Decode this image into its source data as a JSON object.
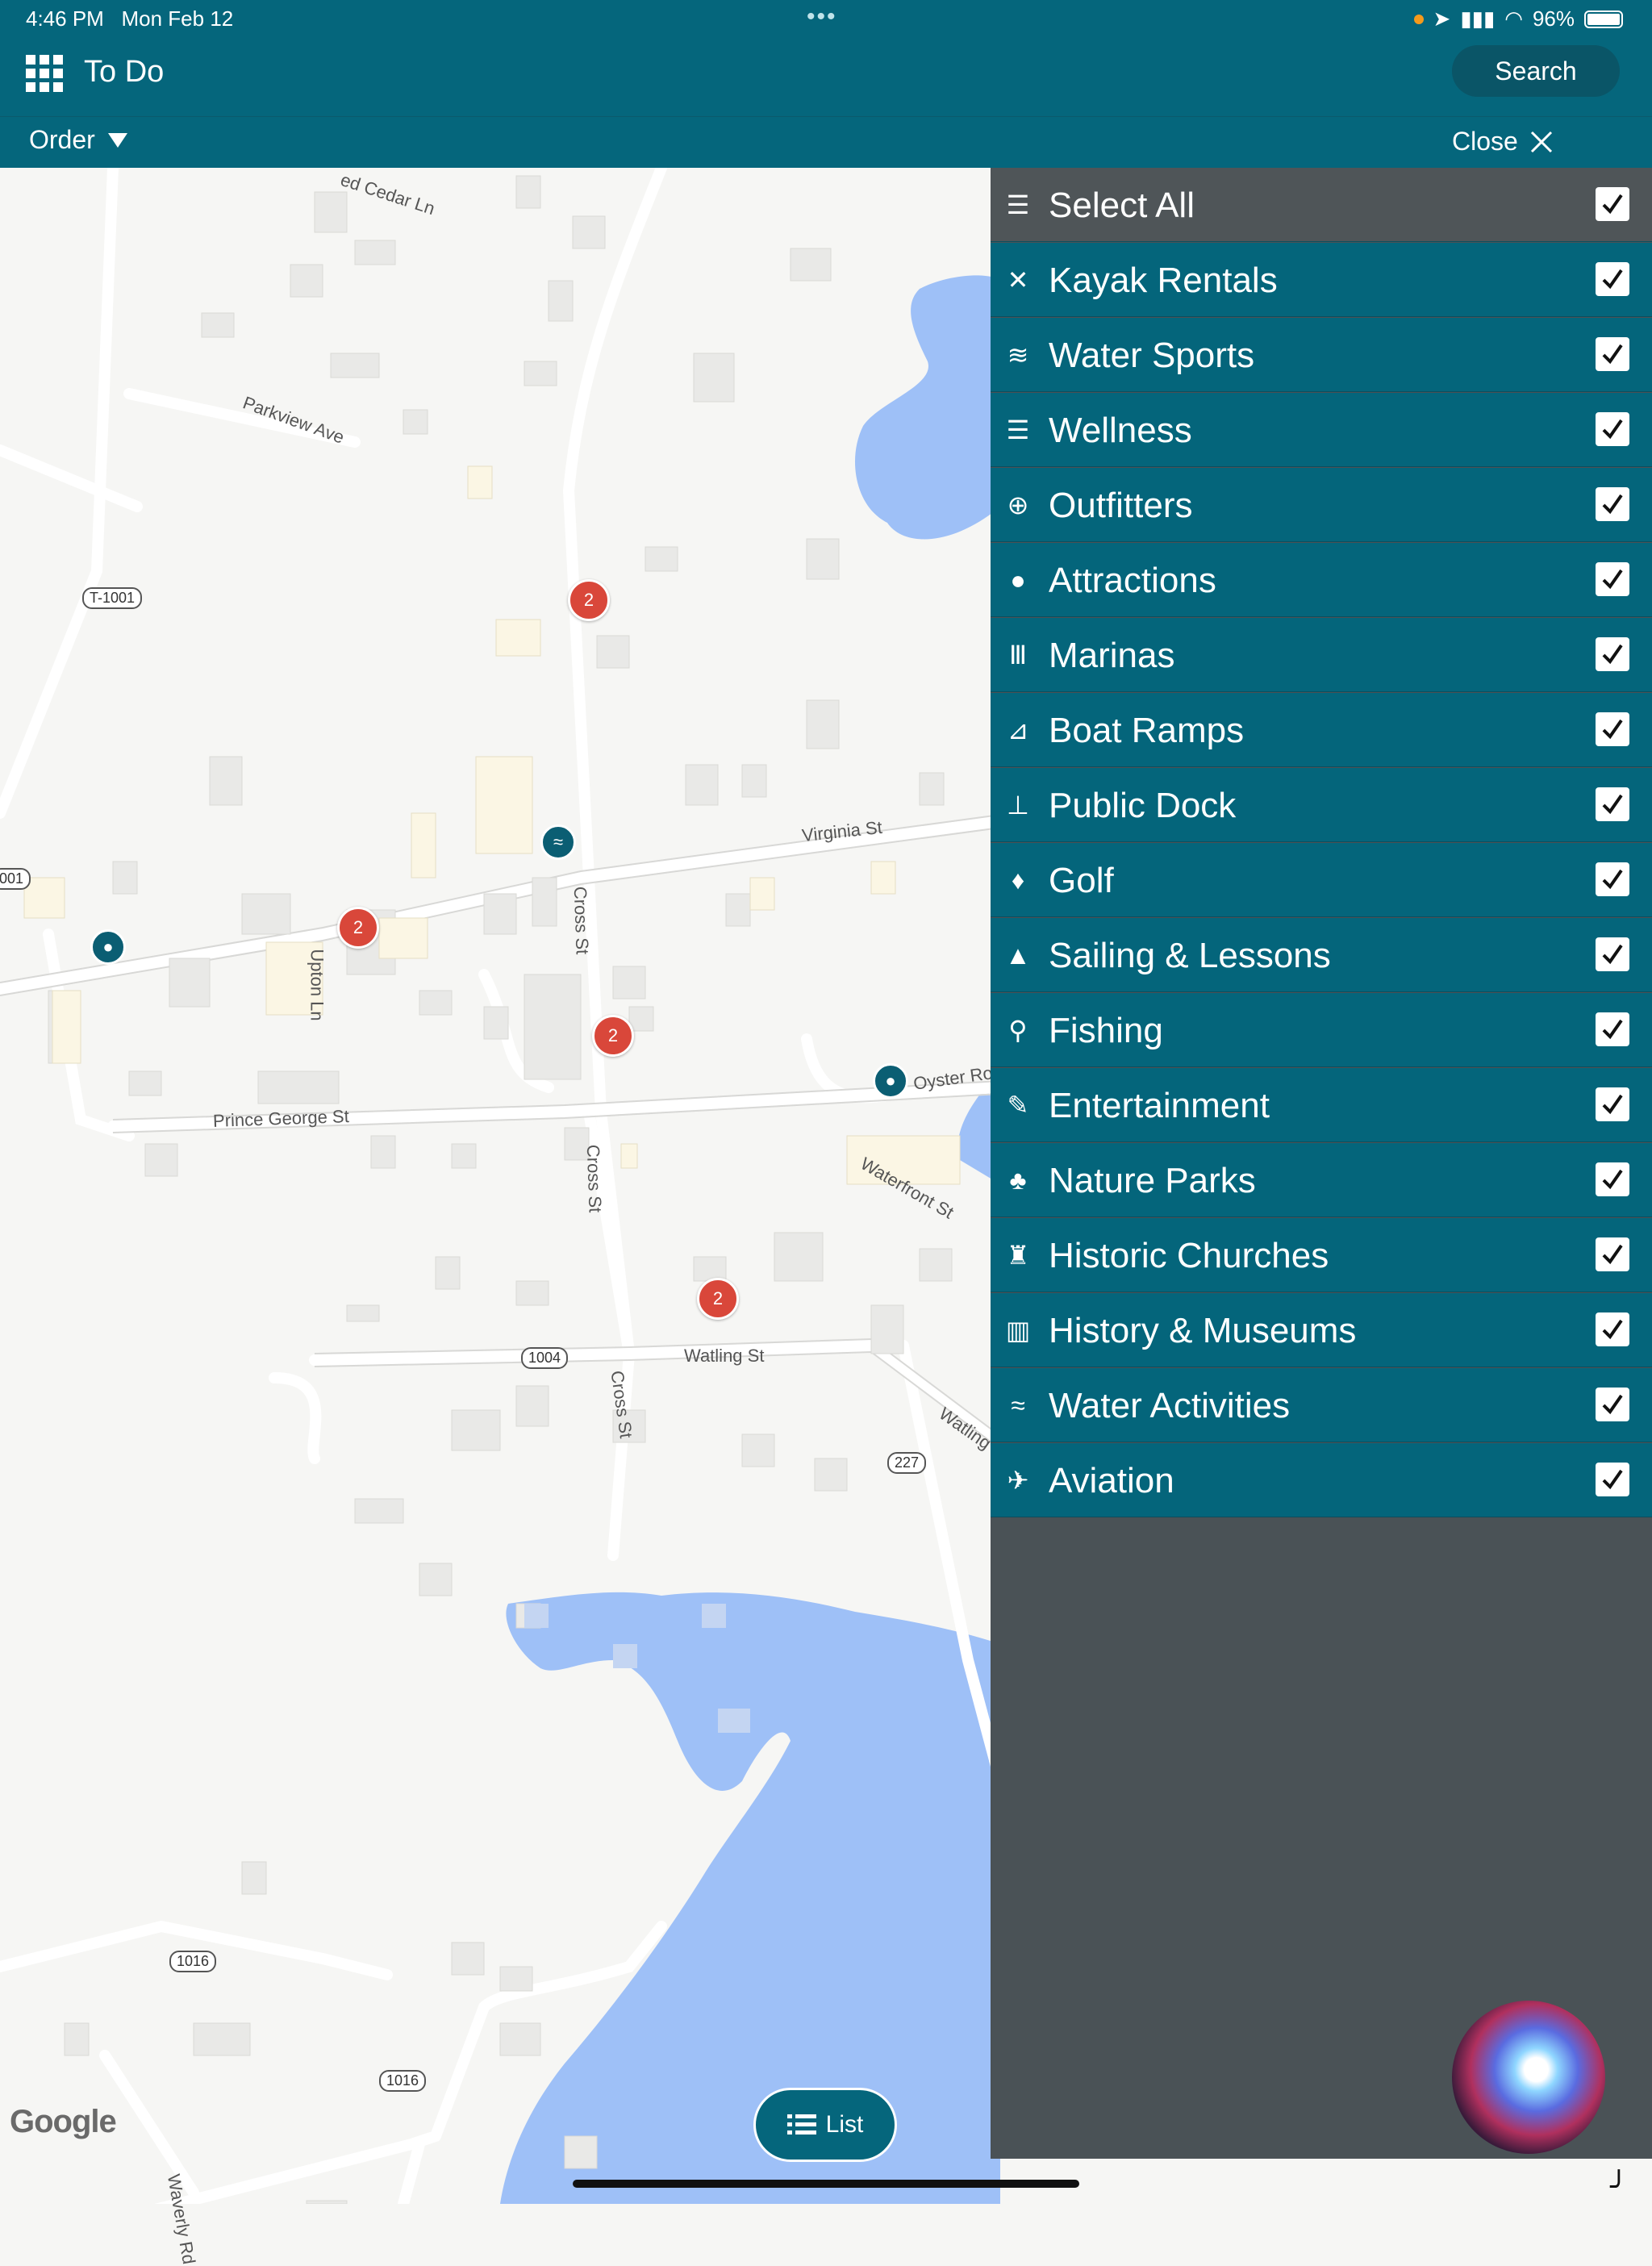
{
  "status_bar": {
    "time": "4:46 PM",
    "date": "Mon Feb 12",
    "battery": "96%",
    "dots": "•••"
  },
  "navbar": {
    "menu_icon": "grid-icon",
    "title": "To Do",
    "search_label": "Search"
  },
  "toolbar": {
    "order_label": "Order",
    "close_label": "Close"
  },
  "map": {
    "streets": {
      "cedar": "ed Cedar Ln",
      "parkview": "Parkview Ave",
      "upton": "Upton Ln",
      "cross1": "Cross St",
      "cross2": "Cross St",
      "cross3": "Cross St",
      "virginia": "Virginia St",
      "prince_george": "Prince George St",
      "oyster": "Oyster Ro",
      "waterfront": "Waterfront St",
      "watling": "Watling St",
      "watling2": "Watling",
      "waverly": "Waverly Rd"
    },
    "shields": {
      "t1001": "T-1001",
      "r001": "001",
      "r1004": "1004",
      "r227": "227",
      "r1016a": "1016",
      "r1016b": "1016"
    },
    "clusters": [
      "2",
      "2",
      "2",
      "2"
    ],
    "google": "Google",
    "list_label": "List"
  },
  "filters": {
    "select_all": {
      "label": "Select All",
      "icon": "list-check-icon",
      "checked": true
    },
    "items": [
      {
        "label": "Kayak Rentals",
        "icon": "kayak-icon",
        "checked": true
      },
      {
        "label": "Water Sports",
        "icon": "waves-icon",
        "checked": true
      },
      {
        "label": "Wellness",
        "icon": "spa-stones-icon",
        "checked": true
      },
      {
        "label": "Outfitters",
        "icon": "compass-icon",
        "checked": true
      },
      {
        "label": "Attractions",
        "icon": "map-pin-icon",
        "checked": true
      },
      {
        "label": "Marinas",
        "icon": "marina-icon",
        "checked": true
      },
      {
        "label": "Boat Ramps",
        "icon": "boat-ramp-icon",
        "checked": true
      },
      {
        "label": "Public Dock",
        "icon": "dock-icon",
        "checked": true
      },
      {
        "label": "Golf",
        "icon": "golf-icon",
        "checked": true
      },
      {
        "label": "Sailing & Lessons",
        "icon": "sailboat-icon",
        "checked": true
      },
      {
        "label": "Fishing",
        "icon": "fishing-icon",
        "checked": true
      },
      {
        "label": "Entertainment",
        "icon": "microphone-icon",
        "checked": true
      },
      {
        "label": "Nature Parks",
        "icon": "tree-icon",
        "checked": true
      },
      {
        "label": "Historic Churches",
        "icon": "church-icon",
        "checked": true
      },
      {
        "label": "History & Museums",
        "icon": "book-icon",
        "checked": true
      },
      {
        "label": "Water Activities",
        "icon": "water-ski-icon",
        "checked": true
      },
      {
        "label": "Aviation",
        "icon": "plane-icon",
        "checked": true
      }
    ]
  },
  "colors": {
    "header": "#05667c",
    "panel_row": "#04657b",
    "select_all_row": "#4f5558",
    "panel_bg": "#4a5256",
    "cluster": "#d9473a",
    "water": "#9ec0f7"
  }
}
